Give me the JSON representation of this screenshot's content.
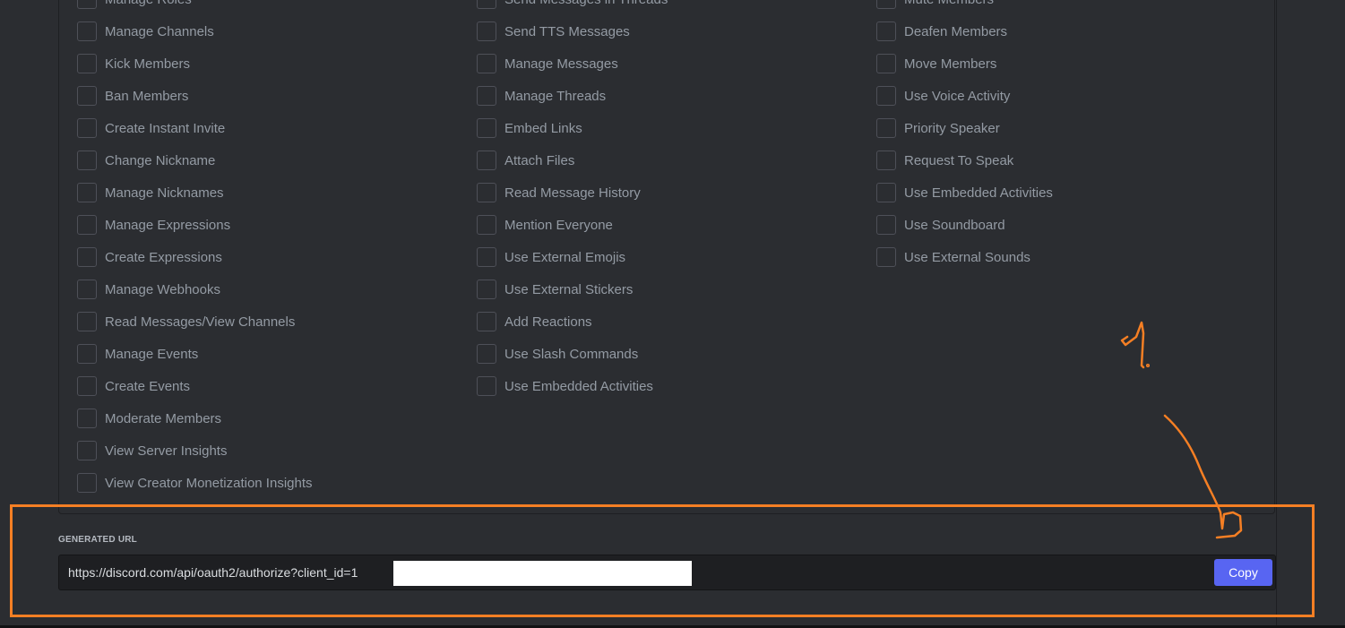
{
  "permissions": {
    "general": [
      "Manage Roles",
      "Manage Channels",
      "Kick Members",
      "Ban Members",
      "Create Instant Invite",
      "Change Nickname",
      "Manage Nicknames",
      "Manage Expressions",
      "Create Expressions",
      "Manage Webhooks",
      "Read Messages/View Channels",
      "Manage Events",
      "Create Events",
      "Moderate Members",
      "View Server Insights",
      "View Creator Monetization Insights"
    ],
    "text": [
      "Send Messages in Threads",
      "Send TTS Messages",
      "Manage Messages",
      "Manage Threads",
      "Embed Links",
      "Attach Files",
      "Read Message History",
      "Mention Everyone",
      "Use External Emojis",
      "Use External Stickers",
      "Add Reactions",
      "Use Slash Commands",
      "Use Embedded Activities"
    ],
    "voice": [
      "Mute Members",
      "Deafen Members",
      "Move Members",
      "Use Voice Activity",
      "Priority Speaker",
      "Request To Speak",
      "Use Embedded Activities",
      "Use Soundboard",
      "Use External Sounds"
    ]
  },
  "generated_url": {
    "label": "GENERATED URL",
    "value": "https://discord.com/api/oauth2/authorize?client_id=1",
    "copy_label": "Copy"
  },
  "annotation": {
    "number": "1",
    "color": "#f57f24"
  },
  "colors": {
    "background": "#2b2d31",
    "field_background": "#1e1f22",
    "button_blurple": "#5865f2",
    "label_text": "#949ba4"
  }
}
